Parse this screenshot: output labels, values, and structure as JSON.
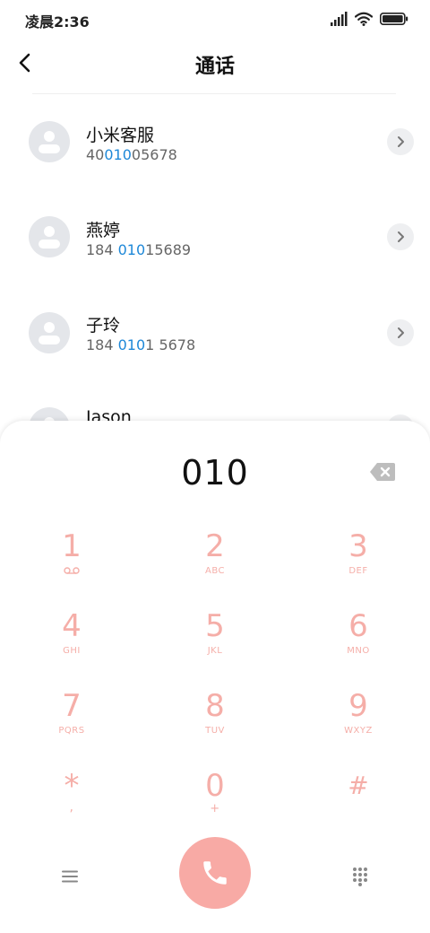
{
  "status_bar": {
    "time": "凌晨2:36"
  },
  "header": {
    "title": "通话"
  },
  "contacts": [
    {
      "name": "小米客服",
      "number_pre": "40",
      "number_match": "010",
      "number_post": "05678"
    },
    {
      "name": "燕婷",
      "number_pre": "184 ",
      "number_match": "010",
      "number_post": "15689"
    },
    {
      "name": "子玲",
      "number_pre": "184 ",
      "number_match": "010",
      "number_post": "1 5678"
    },
    {
      "name": "Jason",
      "number_pre": "",
      "number_match": "",
      "number_post": ""
    }
  ],
  "dialer": {
    "input": "010",
    "keys": [
      {
        "digit": "1",
        "letters": ""
      },
      {
        "digit": "2",
        "letters": "ABC"
      },
      {
        "digit": "3",
        "letters": "DEF"
      },
      {
        "digit": "4",
        "letters": "GHI"
      },
      {
        "digit": "5",
        "letters": "JKL"
      },
      {
        "digit": "6",
        "letters": "MNO"
      },
      {
        "digit": "7",
        "letters": "PQRS"
      },
      {
        "digit": "8",
        "letters": "TUV"
      },
      {
        "digit": "9",
        "letters": "WXYZ"
      },
      {
        "digit": "*",
        "letters": ","
      },
      {
        "digit": "0",
        "letters": "+"
      },
      {
        "digit": "#",
        "letters": ""
      }
    ]
  },
  "colors": {
    "accent_match": "#1e88d8",
    "keypad": "#f5aea8",
    "call_button": "#f8aaa5"
  },
  "icons": [
    "signal-icon",
    "wifi-icon",
    "battery-icon",
    "back-arrow-icon",
    "contact-avatar-icon",
    "chevron-right-icon",
    "backspace-icon",
    "voicemail-icon",
    "menu-icon",
    "phone-icon",
    "keypad-icon"
  ]
}
